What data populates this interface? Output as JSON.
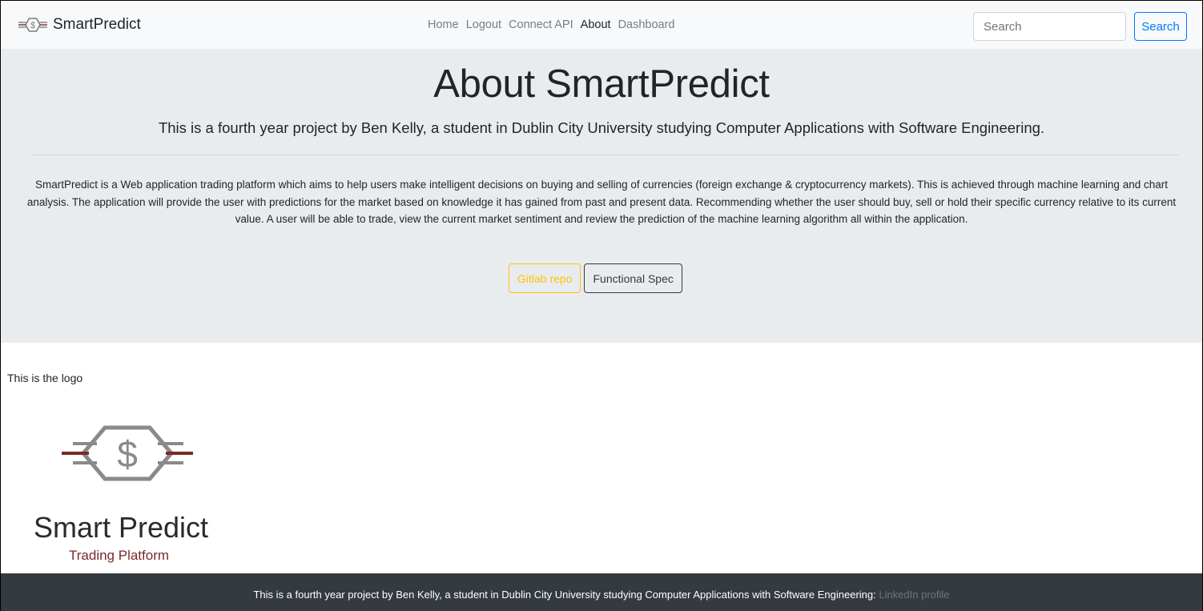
{
  "navbar": {
    "brand": "SmartPredict",
    "links": [
      {
        "label": "Home",
        "active": false
      },
      {
        "label": "Logout",
        "active": false
      },
      {
        "label": "Connect API",
        "active": false
      },
      {
        "label": "About",
        "active": true
      },
      {
        "label": "Dashboard",
        "active": false
      }
    ],
    "search_placeholder": "Search",
    "search_button": "Search"
  },
  "jumbotron": {
    "title": "About SmartPredict",
    "lead": "This is a fourth year project by Ben Kelly, a student in Dublin City University studying Computer Applications with Software Engineering.",
    "description": "SmartPredict is a Web application trading platform which aims to help users make intelligent decisions on buying and selling of currencies (foreign exchange & cryptocurrency markets). This is achieved through machine learning and chart analysis. The application will provide the user with predictions for the market based on knowledge it has gained from past and present data. Recommending whether the user should buy, sell or hold their specific currency relative to its current value. A user will be able to trade, view the current market sentiment and review the prediction of the machine learning algorithm all within the application.",
    "buttons": {
      "gitlab": "Gitlab repo",
      "spec": "Functional Spec"
    }
  },
  "logo_section": {
    "caption": "This is the logo",
    "logo_title": "Smart Predict",
    "logo_subtitle": "Trading Platform",
    "logo_symbol": "$"
  },
  "footer": {
    "text": "This is a fourth year project by Ben Kelly, a student in Dublin City University studying Computer Applications with Software Engineering: ",
    "link": "LinkedIn profile"
  },
  "colors": {
    "navbar_bg": "#f8f9fa",
    "jumbotron_bg": "#e9ecef",
    "footer_bg": "#343a40",
    "primary": "#007bff",
    "warning": "#ffc107",
    "logo_gray": "#8a8a8a",
    "logo_red": "#7a2a2a"
  }
}
